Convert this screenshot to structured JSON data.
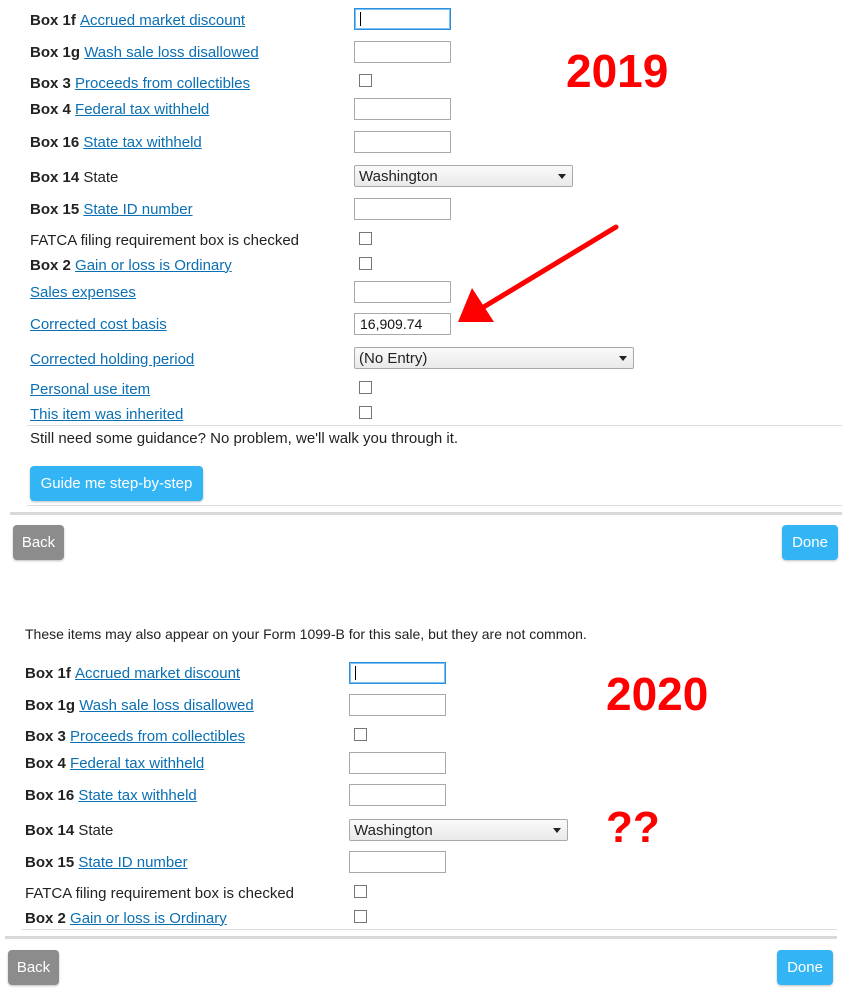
{
  "colors": {
    "link": "#0b6fb3",
    "annotation": "#ff0000",
    "primary_button": "#33b5f5",
    "back_button": "#8c8c8c"
  },
  "annotations": {
    "year_2019": "2019",
    "year_2020": "2020",
    "question": "??"
  },
  "form_2019": {
    "fields": [
      {
        "bold": "Box 1f",
        "link": "Accrued market discount"
      },
      {
        "bold": "Box 1g",
        "link": "Wash sale loss disallowed"
      },
      {
        "bold": "Box 3",
        "link": "Proceeds from collectibles"
      },
      {
        "bold": "Box 4",
        "link": "Federal tax withheld"
      },
      {
        "bold": "Box 16",
        "link": "State tax withheld"
      },
      {
        "bold": "Box 14",
        "plain": "State"
      },
      {
        "bold": "Box 15",
        "link": "State ID number"
      },
      {
        "plain": "FATCA filing requirement box is checked"
      },
      {
        "bold": "Box 2",
        "link": "Gain or loss is Ordinary"
      },
      {
        "link": "Sales expenses"
      },
      {
        "link": "Corrected cost basis"
      },
      {
        "link": "Corrected holding period"
      },
      {
        "link": "Personal use item"
      },
      {
        "link": "This item was inherited"
      }
    ],
    "state_value": "Washington",
    "corrected_cost_basis_value": "16,909.74",
    "holding_period_value": "(No Entry)",
    "guidance_text": "Still need some guidance? No problem, we'll walk you through it.",
    "guide_button": "Guide me step-by-step",
    "back": "Back",
    "done": "Done"
  },
  "form_2020": {
    "intro": "These items may also appear on your Form 1099-B for this sale, but they are not common.",
    "fields": [
      {
        "bold": "Box 1f",
        "link": "Accrued market discount"
      },
      {
        "bold": "Box 1g",
        "link": "Wash sale loss disallowed"
      },
      {
        "bold": "Box 3",
        "link": "Proceeds from collectibles"
      },
      {
        "bold": "Box 4",
        "link": "Federal tax withheld"
      },
      {
        "bold": "Box 16",
        "link": "State tax withheld"
      },
      {
        "bold": "Box 14",
        "plain": "State"
      },
      {
        "bold": "Box 15",
        "link": "State ID number"
      },
      {
        "plain": "FATCA filing requirement box is checked"
      },
      {
        "bold": "Box 2",
        "link": "Gain or loss is Ordinary"
      }
    ],
    "state_value": "Washington",
    "back": "Back",
    "done": "Done"
  }
}
